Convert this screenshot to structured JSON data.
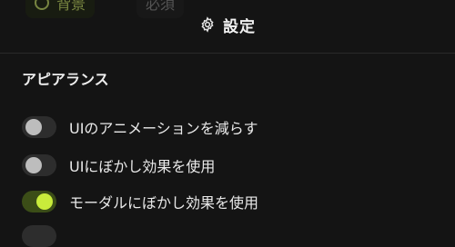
{
  "behind": {
    "pill1_label": "背景",
    "pill2_label": "必須"
  },
  "header": {
    "title": "設定",
    "icon": "gear-icon"
  },
  "section": {
    "title": "アピアランス"
  },
  "settings": [
    {
      "label": "UIのアニメーションを減らす",
      "enabled": false
    },
    {
      "label": "UIにぼかし効果を使用",
      "enabled": false
    },
    {
      "label": "モーダルにぼかし効果を使用",
      "enabled": true
    }
  ],
  "colors": {
    "accent": "#c9ec3b",
    "background": "#141414",
    "toggle_off": "#2d2d2d"
  }
}
